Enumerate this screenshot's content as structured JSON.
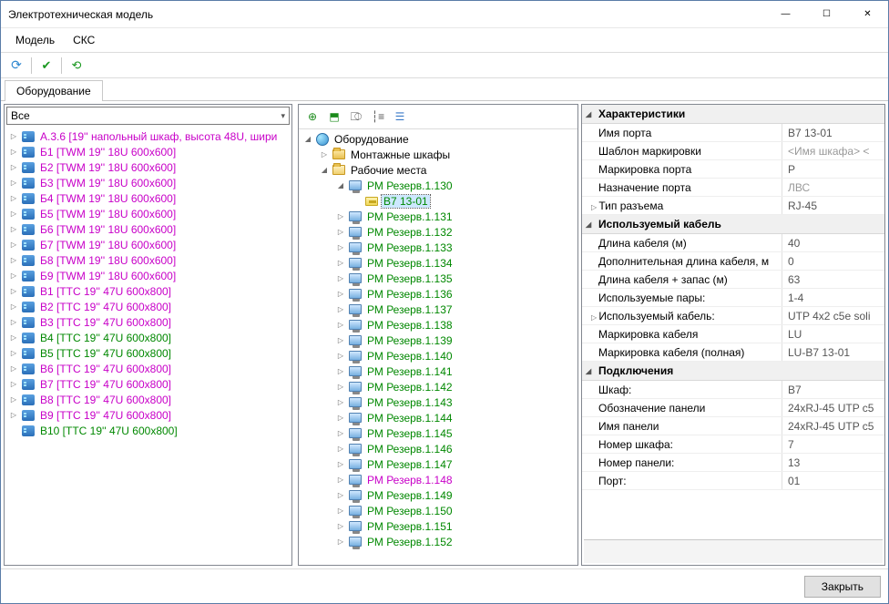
{
  "window": {
    "title": "Электротехническая модель"
  },
  "menubar": [
    "Модель",
    "СКС"
  ],
  "tab": "Оборудование",
  "left_filter": "Все",
  "left_tree": [
    {
      "label": "А.3.6 [19'' напольный шкаф, высота 48U, шири",
      "color": "c-magenta",
      "icon": "server",
      "exp": "closed",
      "indent": 0
    },
    {
      "label": "Б1 [TWM 19'' 18U 600x600]",
      "color": "c-magenta",
      "icon": "server",
      "exp": "closed",
      "indent": 0
    },
    {
      "label": "Б2 [TWM 19'' 18U 600x600]",
      "color": "c-magenta",
      "icon": "server",
      "exp": "closed",
      "indent": 0
    },
    {
      "label": "Б3 [TWM 19'' 18U 600x600]",
      "color": "c-magenta",
      "icon": "server",
      "exp": "closed",
      "indent": 0
    },
    {
      "label": "Б4 [TWM 19'' 18U 600x600]",
      "color": "c-magenta",
      "icon": "server",
      "exp": "closed",
      "indent": 0
    },
    {
      "label": "Б5 [TWM 19'' 18U 600x600]",
      "color": "c-magenta",
      "icon": "server",
      "exp": "closed",
      "indent": 0
    },
    {
      "label": "Б6 [TWM 19'' 18U 600x600]",
      "color": "c-magenta",
      "icon": "server",
      "exp": "closed",
      "indent": 0
    },
    {
      "label": "Б7 [TWM 19'' 18U 600x600]",
      "color": "c-magenta",
      "icon": "server",
      "exp": "closed",
      "indent": 0
    },
    {
      "label": "Б8 [TWM 19'' 18U 600x600]",
      "color": "c-magenta",
      "icon": "server",
      "exp": "closed",
      "indent": 0
    },
    {
      "label": "Б9 [TWM 19'' 18U 600x600]",
      "color": "c-magenta",
      "icon": "server",
      "exp": "closed",
      "indent": 0
    },
    {
      "label": "В1 [TTC 19'' 47U 600x800]",
      "color": "c-magenta",
      "icon": "server",
      "exp": "closed",
      "indent": 0
    },
    {
      "label": "В2 [TTC 19'' 47U 600x800]",
      "color": "c-magenta",
      "icon": "server",
      "exp": "closed",
      "indent": 0
    },
    {
      "label": "В3 [TTC 19'' 47U 600x800]",
      "color": "c-magenta",
      "icon": "server",
      "exp": "closed",
      "indent": 0
    },
    {
      "label": "В4 [TTC 19'' 47U 600x800]",
      "color": "c-green",
      "icon": "server",
      "exp": "closed",
      "indent": 0
    },
    {
      "label": "В5 [TTC 19'' 47U 600x800]",
      "color": "c-green",
      "icon": "server",
      "exp": "closed",
      "indent": 0
    },
    {
      "label": "В6 [TTC 19'' 47U 600x800]",
      "color": "c-magenta",
      "icon": "server",
      "exp": "closed",
      "indent": 0
    },
    {
      "label": "В7 [TTC 19'' 47U 600x800]",
      "color": "c-magenta",
      "icon": "server",
      "exp": "closed",
      "indent": 0
    },
    {
      "label": "В8 [TTC 19'' 47U 600x800]",
      "color": "c-magenta",
      "icon": "server",
      "exp": "closed",
      "indent": 0
    },
    {
      "label": "В9 [TTC 19'' 47U 600x800]",
      "color": "c-magenta",
      "icon": "server",
      "exp": "closed",
      "indent": 0
    },
    {
      "label": "В10 [TTC 19'' 47U 600x800]",
      "color": "c-green",
      "icon": "server",
      "exp": "none",
      "indent": 0
    }
  ],
  "mid_tree": [
    {
      "label": "Оборудование",
      "color": "c-black",
      "icon": "globe",
      "exp": "open",
      "indent": 0
    },
    {
      "label": "Монтажные шкафы",
      "color": "c-black",
      "icon": "folder",
      "exp": "closed",
      "indent": 1
    },
    {
      "label": "Рабочие места",
      "color": "c-black",
      "icon": "folder-open",
      "exp": "open",
      "indent": 1
    },
    {
      "label": "РМ Резерв.1.130",
      "color": "c-green",
      "icon": "pc",
      "exp": "open",
      "indent": 2
    },
    {
      "label": "В7 13-01",
      "color": "c-green",
      "icon": "port",
      "exp": "none",
      "indent": 3,
      "selected": true
    },
    {
      "label": "РМ Резерв.1.131",
      "color": "c-green",
      "icon": "pc",
      "exp": "closed",
      "indent": 2
    },
    {
      "label": "РМ Резерв.1.132",
      "color": "c-green",
      "icon": "pc",
      "exp": "closed",
      "indent": 2
    },
    {
      "label": "РМ Резерв.1.133",
      "color": "c-green",
      "icon": "pc",
      "exp": "closed",
      "indent": 2
    },
    {
      "label": "РМ Резерв.1.134",
      "color": "c-green",
      "icon": "pc",
      "exp": "closed",
      "indent": 2
    },
    {
      "label": "РМ Резерв.1.135",
      "color": "c-green",
      "icon": "pc",
      "exp": "closed",
      "indent": 2
    },
    {
      "label": "РМ Резерв.1.136",
      "color": "c-green",
      "icon": "pc",
      "exp": "closed",
      "indent": 2
    },
    {
      "label": "РМ Резерв.1.137",
      "color": "c-green",
      "icon": "pc",
      "exp": "closed",
      "indent": 2
    },
    {
      "label": "РМ Резерв.1.138",
      "color": "c-green",
      "icon": "pc",
      "exp": "closed",
      "indent": 2
    },
    {
      "label": "РМ Резерв.1.139",
      "color": "c-green",
      "icon": "pc",
      "exp": "closed",
      "indent": 2
    },
    {
      "label": "РМ Резерв.1.140",
      "color": "c-green",
      "icon": "pc",
      "exp": "closed",
      "indent": 2
    },
    {
      "label": "РМ Резерв.1.141",
      "color": "c-green",
      "icon": "pc",
      "exp": "closed",
      "indent": 2
    },
    {
      "label": "РМ Резерв.1.142",
      "color": "c-green",
      "icon": "pc",
      "exp": "closed",
      "indent": 2
    },
    {
      "label": "РМ Резерв.1.143",
      "color": "c-green",
      "icon": "pc",
      "exp": "closed",
      "indent": 2
    },
    {
      "label": "РМ Резерв.1.144",
      "color": "c-green",
      "icon": "pc",
      "exp": "closed",
      "indent": 2
    },
    {
      "label": "РМ Резерв.1.145",
      "color": "c-green",
      "icon": "pc",
      "exp": "closed",
      "indent": 2
    },
    {
      "label": "РМ Резерв.1.146",
      "color": "c-green",
      "icon": "pc",
      "exp": "closed",
      "indent": 2
    },
    {
      "label": "РМ Резерв.1.147",
      "color": "c-green",
      "icon": "pc",
      "exp": "closed",
      "indent": 2
    },
    {
      "label": "РМ Резерв.1.148",
      "color": "c-magenta",
      "icon": "pc",
      "exp": "closed",
      "indent": 2
    },
    {
      "label": "РМ Резерв.1.149",
      "color": "c-green",
      "icon": "pc",
      "exp": "closed",
      "indent": 2
    },
    {
      "label": "РМ Резерв.1.150",
      "color": "c-green",
      "icon": "pc",
      "exp": "closed",
      "indent": 2
    },
    {
      "label": "РМ Резерв.1.151",
      "color": "c-green",
      "icon": "pc",
      "exp": "closed",
      "indent": 2
    },
    {
      "label": "РМ Резерв.1.152",
      "color": "c-green",
      "icon": "pc",
      "exp": "closed",
      "indent": 2
    }
  ],
  "props": {
    "sections": [
      {
        "title": "Характеристики",
        "rows": [
          {
            "k": "Имя порта",
            "v": "В7 13-01"
          },
          {
            "k": "Шаблон маркировки",
            "v": "<Имя шкафа> <",
            "placeholder": true
          },
          {
            "k": "Маркировка порта",
            "v": "Р"
          },
          {
            "k": "Назначение порта",
            "v": "ЛВС",
            "placeholder": true
          },
          {
            "k": "Тип разъема",
            "v": "RJ-45",
            "sub": true,
            "arrow": true
          }
        ]
      },
      {
        "title": "Используемый кабель",
        "rows": [
          {
            "k": "Длина кабеля (м)",
            "v": "40"
          },
          {
            "k": "Дополнительная длина кабеля, м",
            "v": "0"
          },
          {
            "k": "Длина кабеля + запас (м)",
            "v": "63"
          },
          {
            "k": "Используемые пары:",
            "v": "1-4"
          },
          {
            "k": "Используемый кабель:",
            "v": "UTP 4x2 c5e soli",
            "sub": true,
            "arrow": true
          },
          {
            "k": "Маркировка кабеля",
            "v": "LU"
          },
          {
            "k": "Маркировка кабеля (полная)",
            "v": "LU-В7 13-01"
          }
        ]
      },
      {
        "title": "Подключения",
        "rows": [
          {
            "k": "Шкаф:",
            "v": "В7"
          },
          {
            "k": "Обозначение панели",
            "v": "24xRJ-45 UTP c5"
          },
          {
            "k": "Имя панели",
            "v": "24xRJ-45 UTP c5"
          },
          {
            "k": "Номер шкафа:",
            "v": "7"
          },
          {
            "k": "Номер панели:",
            "v": "13"
          },
          {
            "k": "Порт:",
            "v": "01"
          }
        ]
      }
    ]
  },
  "close_btn": "Закрыть"
}
